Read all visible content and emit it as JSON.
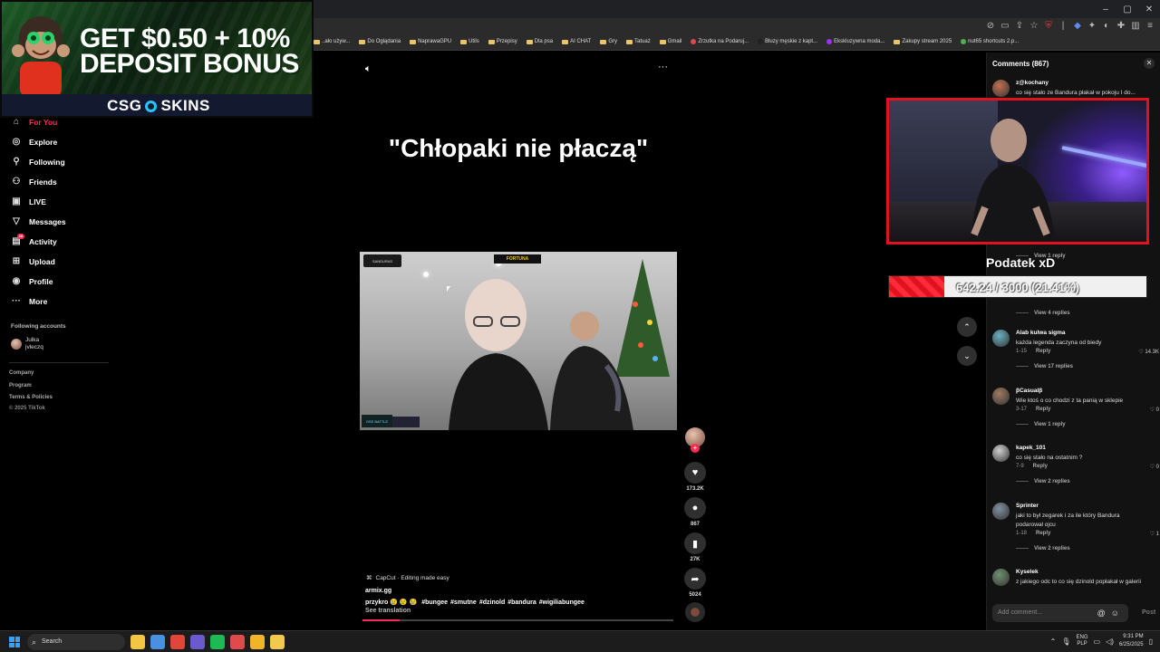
{
  "window": {
    "controls": [
      "–",
      "▢",
      "✕"
    ]
  },
  "bookmarks": [
    {
      "label": "..ało używ...",
      "kind": "folder"
    },
    {
      "label": "Do Oglądania",
      "kind": "folder"
    },
    {
      "label": "NaprawaGPU",
      "kind": "folder"
    },
    {
      "label": "Utils",
      "kind": "folder"
    },
    {
      "label": "Przepisy",
      "kind": "folder"
    },
    {
      "label": "Dla psa",
      "kind": "folder"
    },
    {
      "label": "AI CHAT",
      "kind": "folder"
    },
    {
      "label": "Gry",
      "kind": "folder"
    },
    {
      "label": "Tatuaż",
      "kind": "folder"
    },
    {
      "label": "Gmail",
      "kind": "folder"
    },
    {
      "label": "Zrzutka na Podaruj...",
      "kind": "site",
      "color": "#e04848"
    },
    {
      "label": "Bluzy męskie z kapt...",
      "kind": "site",
      "color": "#222222"
    },
    {
      "label": "Ekskluzywna moda...",
      "kind": "site",
      "color": "#9b30ff"
    },
    {
      "label": "Zakupy stream 2025",
      "kind": "folder"
    },
    {
      "label": "nut65 shortcuts 2.p...",
      "kind": "site",
      "color": "#4caf50"
    }
  ],
  "ad": {
    "line1": "GET $0.50 + 10%",
    "line2": "DEPOSIT BONUS",
    "brand_left": "CSG",
    "brand_right": "SKINS"
  },
  "sidebar": {
    "items": [
      {
        "label": "For You",
        "icon": "home-icon",
        "glyph": "⌂",
        "active": true
      },
      {
        "label": "Explore",
        "icon": "compass-icon",
        "glyph": "◎"
      },
      {
        "label": "Following",
        "icon": "following-icon",
        "glyph": "⚲"
      },
      {
        "label": "Friends",
        "icon": "friends-icon",
        "glyph": "⚇"
      },
      {
        "label": "LIVE",
        "icon": "live-icon",
        "glyph": "▣"
      },
      {
        "label": "Messages",
        "icon": "messages-icon",
        "glyph": "▽"
      },
      {
        "label": "Activity",
        "icon": "activity-icon",
        "glyph": "▤",
        "badge": "16"
      },
      {
        "label": "Upload",
        "icon": "upload-icon",
        "glyph": "⊞"
      },
      {
        "label": "Profile",
        "icon": "profile-icon",
        "glyph": "◉"
      },
      {
        "label": "More",
        "icon": "more-icon",
        "glyph": "···"
      }
    ],
    "following_accounts_label": "Following accounts",
    "account": {
      "line1": "Julka",
      "line2": "jvleczq"
    },
    "footer": [
      "Company",
      "Program",
      "Terms & Policies",
      "© 2025 TikTok"
    ]
  },
  "video": {
    "title": "\"Chłopaki nie płaczą\"",
    "capcut": "CapCut · Editing made easy",
    "author": "armix.gg",
    "caption_prefix": "przykro 😢 😢 😢",
    "hashtags": [
      "#bungee",
      "#smutne",
      "#dzinold",
      "#bandura",
      "#wigiliabungee"
    ],
    "see_translation": "See translation",
    "progress": 0.12,
    "frame_logos": [
      "SANDURAS",
      "FORTUNA",
      "OSE BATTLE",
      ""
    ]
  },
  "actions": {
    "likes": "173.2K",
    "comments": "867",
    "saves": "27K",
    "shares": "5024"
  },
  "comments_panel": {
    "title": "Comments (867)",
    "input_placeholder": "Add comment...",
    "post_label": "Post",
    "items": [
      {
        "user": "z@kochany",
        "text": "co się stało ze Bandura płakał w pokoju I do...",
        "meta": "",
        "likes": "",
        "view": "",
        "color": "#c07050"
      },
      {
        "user": "Alab kulwa sigma",
        "text": "każda legenda zaczyna od biedy",
        "meta": "1-15",
        "reply": "Reply",
        "likes": "14.3K",
        "view": "View 17 replies",
        "color": "#6ab0c0"
      },
      {
        "user": "βCasualβ",
        "text": "Wie ktoś o co chodzi z ta panią w sklepie",
        "meta": "3-17",
        "reply": "Reply",
        "likes": "0",
        "view": "View 1 reply",
        "color": "#a07a60"
      },
      {
        "user": "kapek_101",
        "text": "co się stało na ostatnim ?",
        "meta": "7-9",
        "reply": "Reply",
        "likes": "0",
        "view": "View 2 replies",
        "color": "#d0d0d0"
      },
      {
        "user": "Sprinter",
        "text": "jaki to był zegarek i za ile który Bandura podarował ojcu",
        "meta": "1-18",
        "reply": "Reply",
        "likes": "1",
        "view": "View 2 replies",
        "color": "#8090a0"
      },
      {
        "user": "Kyselek",
        "text": "z jakiego odc to co się dzinold popłakał w galerii",
        "meta": "",
        "reply": "",
        "likes": "",
        "view": "",
        "color": "#709070"
      }
    ],
    "hidden_views": [
      "View 1 reply",
      "View 4 replies"
    ]
  },
  "stream_overlay": {
    "goal_title": "Podatek xD",
    "goal_text": "642.24 / 3000 (21.41%)",
    "goal_fraction": 0.2141
  },
  "taskbar": {
    "search": "Search",
    "apps": [
      "#f4c542",
      "#4a90e2",
      "#e2463a",
      "#6a5acd",
      "#1db954",
      "#e04a4a",
      "#f0b429",
      "#f2c94c"
    ],
    "lang_line1": "ENG",
    "lang_line2": "PLP",
    "time": "9:31 PM",
    "date": "6/25/2025"
  }
}
